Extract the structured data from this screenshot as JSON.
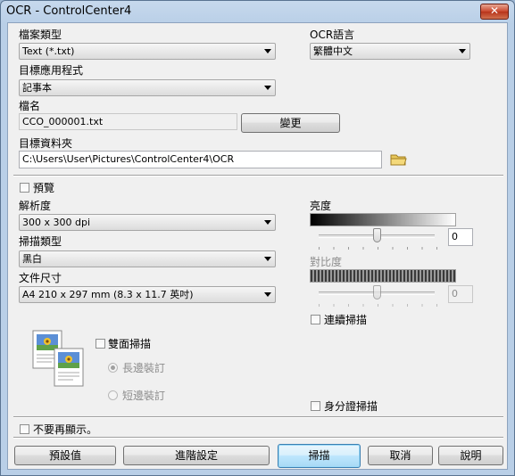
{
  "window": {
    "title": "OCR - ControlCenter4",
    "close_glyph": "✕"
  },
  "file_type": {
    "label": "檔案類型",
    "value": "Text (*.txt)"
  },
  "ocr_language": {
    "label": "OCR語言",
    "value": "繁體中文"
  },
  "target_app": {
    "label": "目標應用程式",
    "value": "記事本"
  },
  "file_name": {
    "label": "檔名",
    "value": "CCO_000001.txt",
    "change_button": "變更"
  },
  "target_folder": {
    "label": "目標資料夾",
    "value": "C:\\Users\\User\\Pictures\\ControlCenter4\\OCR",
    "icon": "folder-icon"
  },
  "preview": {
    "label": "預覽",
    "checked": false
  },
  "resolution": {
    "label": "解析度",
    "value": "300 x 300 dpi"
  },
  "scan_type": {
    "label": "掃描類型",
    "value": "黑白"
  },
  "document_size": {
    "label": "文件尺寸",
    "value": "A4 210 x 297 mm (8.3 x 11.7 英吋)"
  },
  "brightness": {
    "label": "亮度",
    "value": "0",
    "level": 0.5
  },
  "contrast": {
    "label": "對比度",
    "value": "0",
    "level": 0.5,
    "enabled": false
  },
  "continuous_scan": {
    "label": "連續掃描",
    "checked": false
  },
  "duplex": {
    "label": "雙面掃描",
    "checked": false,
    "options": [
      {
        "label": "長邊裝訂",
        "selected": true
      },
      {
        "label": "短邊裝訂",
        "selected": false
      }
    ]
  },
  "id_card_scan": {
    "label": "身分證掃描",
    "checked": false
  },
  "dont_show_again": {
    "label": "不要再顯示。",
    "checked": false
  },
  "buttons": {
    "default": "預設值",
    "advanced": "進階設定",
    "scan": "掃描",
    "cancel": "取消",
    "help": "說明"
  }
}
